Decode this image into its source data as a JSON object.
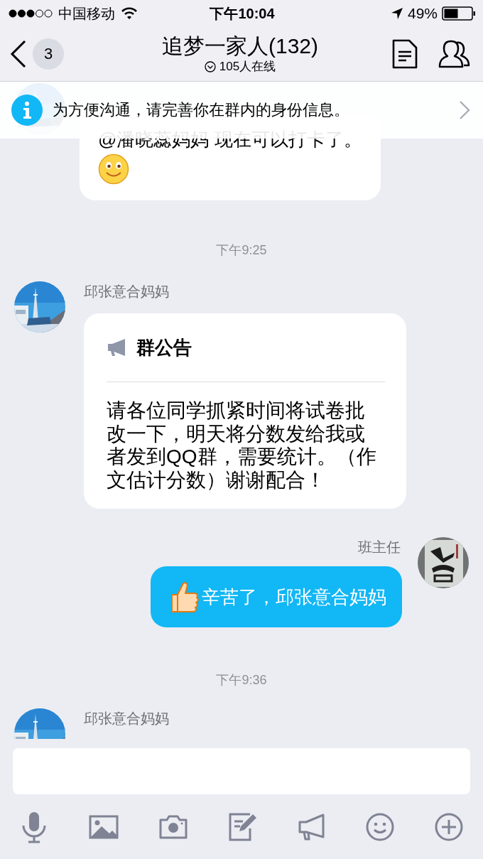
{
  "status_bar": {
    "carrier": "中国移动",
    "time": "下午10:04",
    "battery": "49%"
  },
  "nav": {
    "back_count": "3",
    "title": "追梦一家人(132)",
    "online": "105人在线"
  },
  "banner": {
    "text": "为方便沟通，请完善你在群内的身份信息。"
  },
  "messages": [
    {
      "kind": "incoming",
      "text": "@潘晓蕊妈妈 现在可以打卡了。",
      "emoji": true
    },
    {
      "kind": "timestamp",
      "text": "下午9:25"
    },
    {
      "kind": "announcement",
      "sender": "邱张意合妈妈",
      "title": "群公告",
      "text": "请各位同学抓紧时间将试卷批改一下，明天将分数发给我或者发到QQ群，需要统计。（作文估计分数）谢谢配合！"
    },
    {
      "kind": "outgoing",
      "sender": "班主任",
      "emoji": true,
      "text": "辛苦了，邱张意合妈妈"
    },
    {
      "kind": "timestamp",
      "text": "下午9:36"
    },
    {
      "kind": "incoming",
      "sender": "邱张意合妈妈"
    }
  ]
}
